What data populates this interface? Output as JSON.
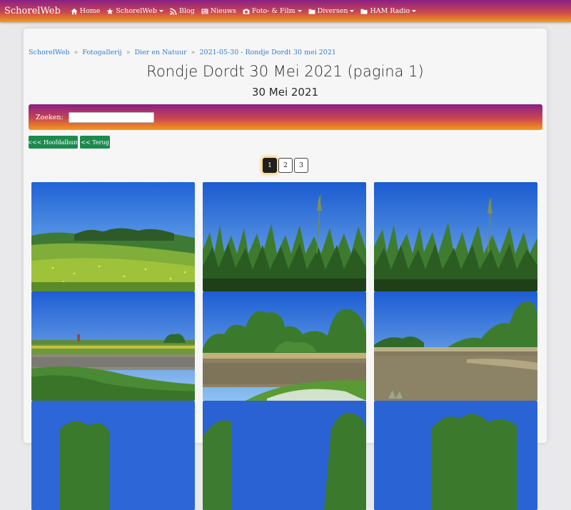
{
  "navbar": {
    "brand": "SchorelWeb",
    "items": [
      {
        "label": "Home",
        "icon": "home-icon"
      },
      {
        "label": "SchorelWeb",
        "icon": "star-icon",
        "dropdown": true
      },
      {
        "label": "Blog",
        "icon": "rss-icon"
      },
      {
        "label": "Nieuws",
        "icon": "newspaper-icon"
      },
      {
        "label": "Foto- & Film",
        "icon": "camera-icon",
        "dropdown": true
      },
      {
        "label": "Diversen",
        "icon": "folder-icon",
        "dropdown": true
      },
      {
        "label": "HAM Radio",
        "icon": "folder-icon",
        "dropdown": true
      }
    ]
  },
  "breadcrumb": {
    "items": [
      "SchorelWeb",
      "Fotogallerij",
      "Dier en Natuur",
      "2021-05-30 - Rondje Dordt 30 mei 2021"
    ],
    "separator": "»"
  },
  "page": {
    "title": "Rondje Dordt 30 Mei 2021 (pagina 1)",
    "subtitle": "30 Mei 2021"
  },
  "search": {
    "label": "Zoeken:",
    "value": ""
  },
  "buttons": {
    "main_album": "<<< Hoofdalbum",
    "back": "<< Terug"
  },
  "pagination": {
    "pages": [
      "1",
      "2",
      "3"
    ],
    "current": "1"
  },
  "colors": {
    "gradient_top": "#8a1f86",
    "gradient_mid": "#c9474f",
    "gradient_bottom": "#f79a17",
    "link": "#2e7fd7",
    "button_green": "#1c8a4e"
  },
  "photos": [
    {
      "scene": "meadow"
    },
    {
      "scene": "reeds"
    },
    {
      "scene": "reeds"
    },
    {
      "scene": "river-field"
    },
    {
      "scene": "river-trees"
    },
    {
      "scene": "river-wide"
    },
    {
      "scene": "partial"
    },
    {
      "scene": "partial"
    },
    {
      "scene": "partial"
    }
  ]
}
